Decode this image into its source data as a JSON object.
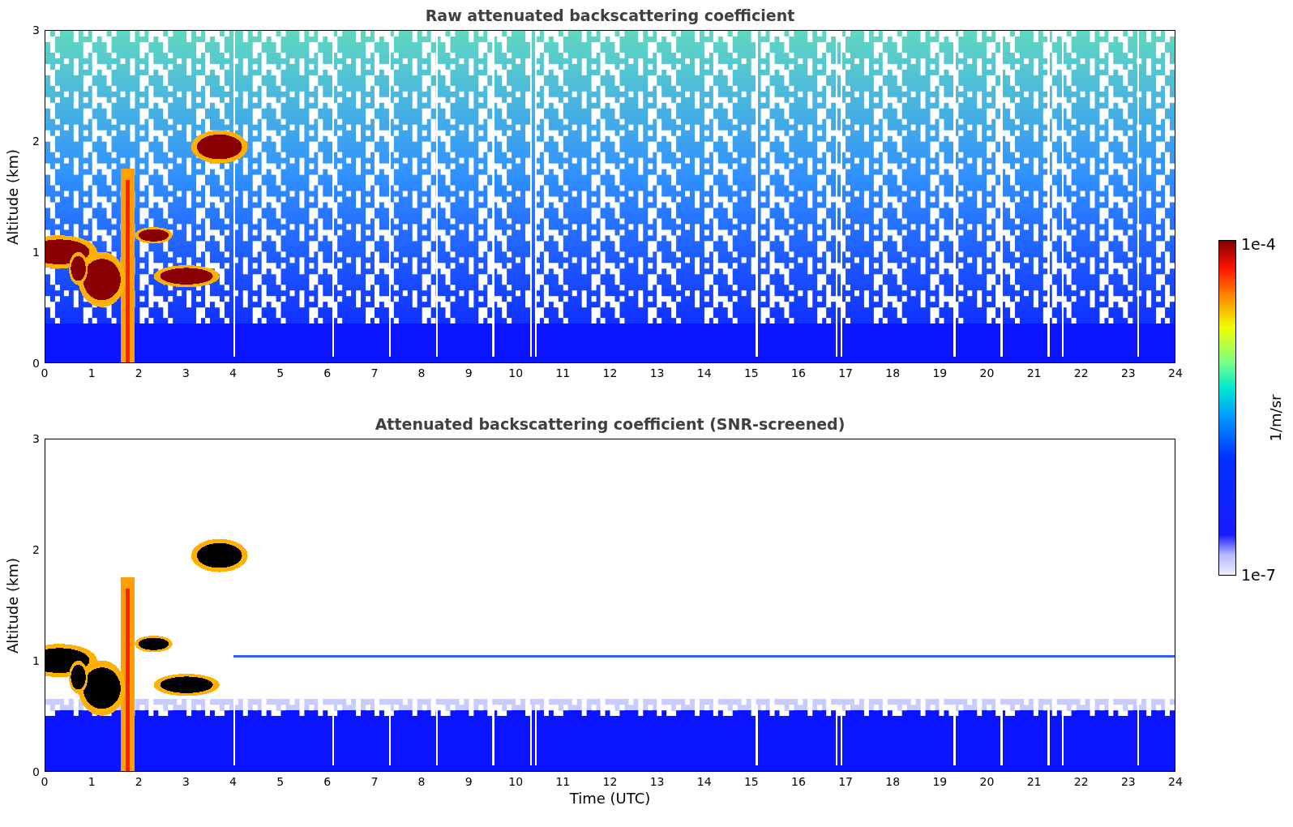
{
  "panels": [
    {
      "title": "Raw attenuated backscattering coefficient",
      "ylabel": "Altitude (km)",
      "yticks": [
        "3",
        "2",
        "1",
        "0"
      ],
      "xticks": [
        "0",
        "1",
        "2",
        "3",
        "4",
        "5",
        "6",
        "7",
        "8",
        "9",
        "10",
        "11",
        "12",
        "13",
        "14",
        "15",
        "16",
        "17",
        "18",
        "19",
        "20",
        "21",
        "22",
        "23",
        "24"
      ],
      "kind": "raw"
    },
    {
      "title": "Attenuated backscattering coefficient (SNR-screened)",
      "ylabel": "Altitude (km)",
      "yticks": [
        "3",
        "2",
        "1",
        "0"
      ],
      "xticks": [
        "0",
        "1",
        "2",
        "3",
        "4",
        "5",
        "6",
        "7",
        "8",
        "9",
        "10",
        "11",
        "12",
        "13",
        "14",
        "15",
        "16",
        "17",
        "18",
        "19",
        "20",
        "21",
        "22",
        "23",
        "24"
      ],
      "xlabel": "Time (UTC)",
      "kind": "screened"
    }
  ],
  "colorbar": {
    "max": "1e-4",
    "min": "1e-7",
    "unit": "1/m/sr"
  }
}
